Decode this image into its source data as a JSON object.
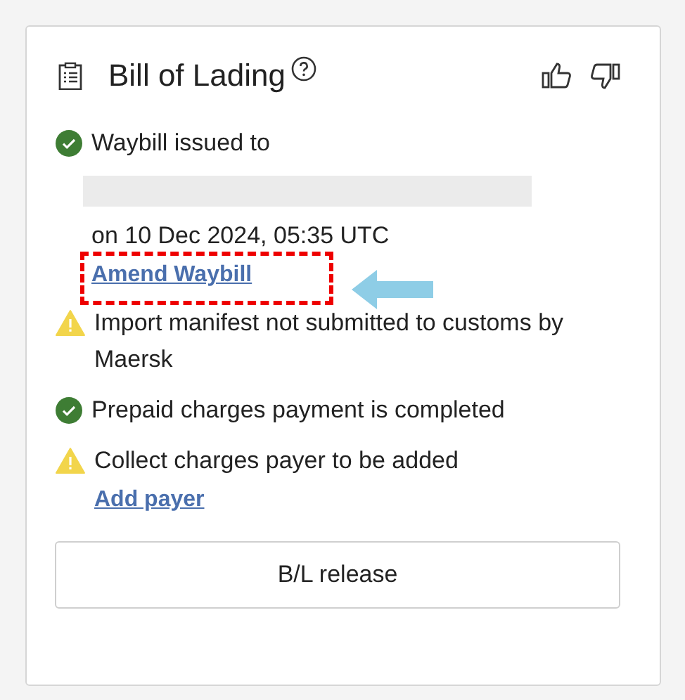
{
  "card": {
    "title": "Bill of Lading"
  },
  "items": [
    {
      "kind": "success",
      "text": "Waybill issued to",
      "redacted": true,
      "detail": "on 10 Dec 2024, 05:35 UTC",
      "link": "Amend Waybill",
      "highlighted": true
    },
    {
      "kind": "warning",
      "text": "Import manifest not submitted to customs by Maersk"
    },
    {
      "kind": "success",
      "text": "Prepaid charges payment is completed"
    },
    {
      "kind": "warning",
      "text": "Collect charges payer to be added",
      "link": "Add payer"
    }
  ],
  "button": "B/L release"
}
